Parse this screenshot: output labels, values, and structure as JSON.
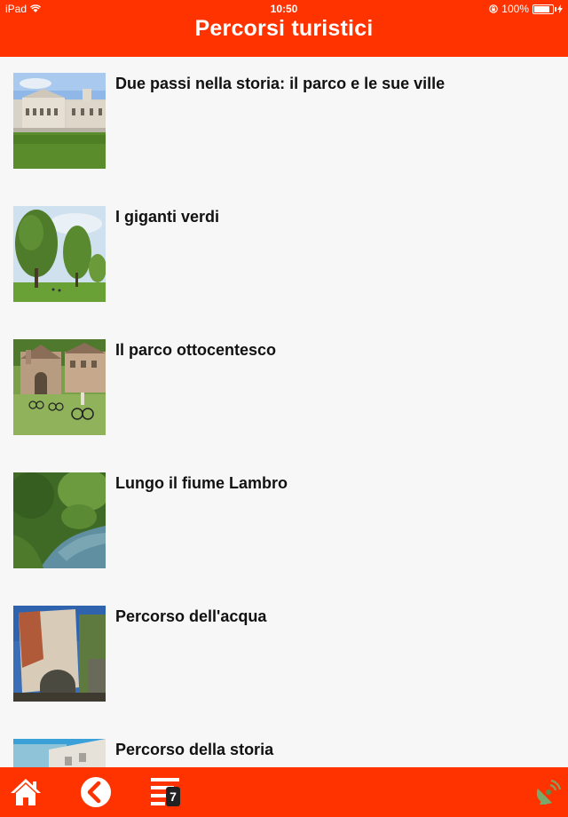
{
  "status_bar": {
    "carrier": "iPad",
    "time": "10:50",
    "battery": "100%"
  },
  "header": {
    "title": "Percorsi turistici"
  },
  "routes": [
    {
      "title": "Due passi nella storia: il parco e le sue ville",
      "image": "villa-photo"
    },
    {
      "title": "I giganti verdi",
      "image": "trees-photo"
    },
    {
      "title": "Il parco ottocentesco",
      "image": "church-cyclists-photo"
    },
    {
      "title": "Lungo il fiume Lambro",
      "image": "river-photo"
    },
    {
      "title": "Percorso dell'acqua",
      "image": "mill-bridge-photo"
    },
    {
      "title": "Percorso della storia",
      "image": "building-photo"
    }
  ],
  "footer": {
    "home_icon": "home-icon",
    "back_icon": "back-icon",
    "list_icon": "list-icon",
    "list_badge": "7",
    "satellite_icon": "satellite-icon"
  },
  "colors": {
    "accent": "#ff3300",
    "background": "#f7f7f7",
    "text": "#111111"
  }
}
